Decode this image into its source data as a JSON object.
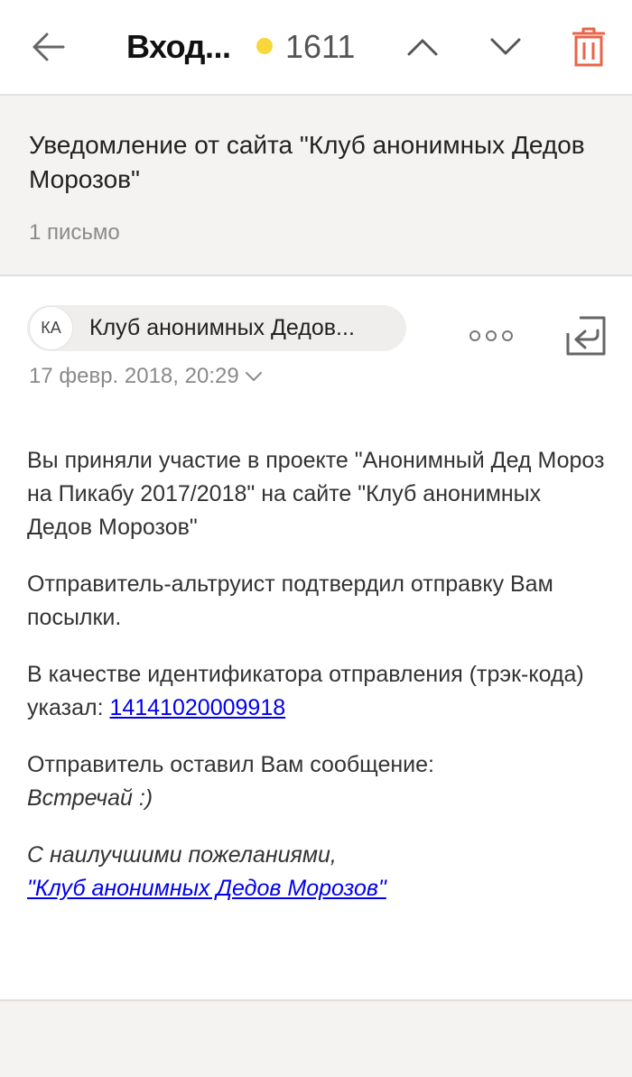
{
  "header": {
    "folder_title": "Вход...",
    "unread_count": "1611",
    "unread_dot_color": "#f7d73c",
    "accent_delete_color": "#e8644a",
    "icons": [
      "back-arrow-icon",
      "chevron-up-icon",
      "chevron-down-icon",
      "trash-icon"
    ]
  },
  "thread": {
    "subject": "Уведомление от сайта \"Клуб анонимных Дедов Морозов\"",
    "count_label": "1 письмо"
  },
  "message": {
    "sender_initials": "КА",
    "sender_name": "Клуб анонимных Дедов...",
    "date": "17 февр. 2018, 20:29",
    "icons": [
      "more-icon",
      "reply-icon",
      "chevron-down-icon"
    ]
  },
  "body": {
    "p1": "Вы приняли участие в проекте \"Анонимный Дед Мороз на Пикабу 2017/2018\" на сайте \"Клуб анонимных Дедов Морозов\"",
    "p2": "Отправитель-альтруист подтвердил отправку Вам посылки.",
    "p3_prefix": "В качестве идентификатора отправления (трэк-кода) указал: ",
    "tracking_code": "14141020009918",
    "p4_line1": "Отправитель оставил Вам сообщение:",
    "p4_message": "Встречай :)",
    "signoff": "С наилучшими пожеланиями,",
    "signature_link": "\"Клуб анонимных Дедов Морозов\""
  }
}
